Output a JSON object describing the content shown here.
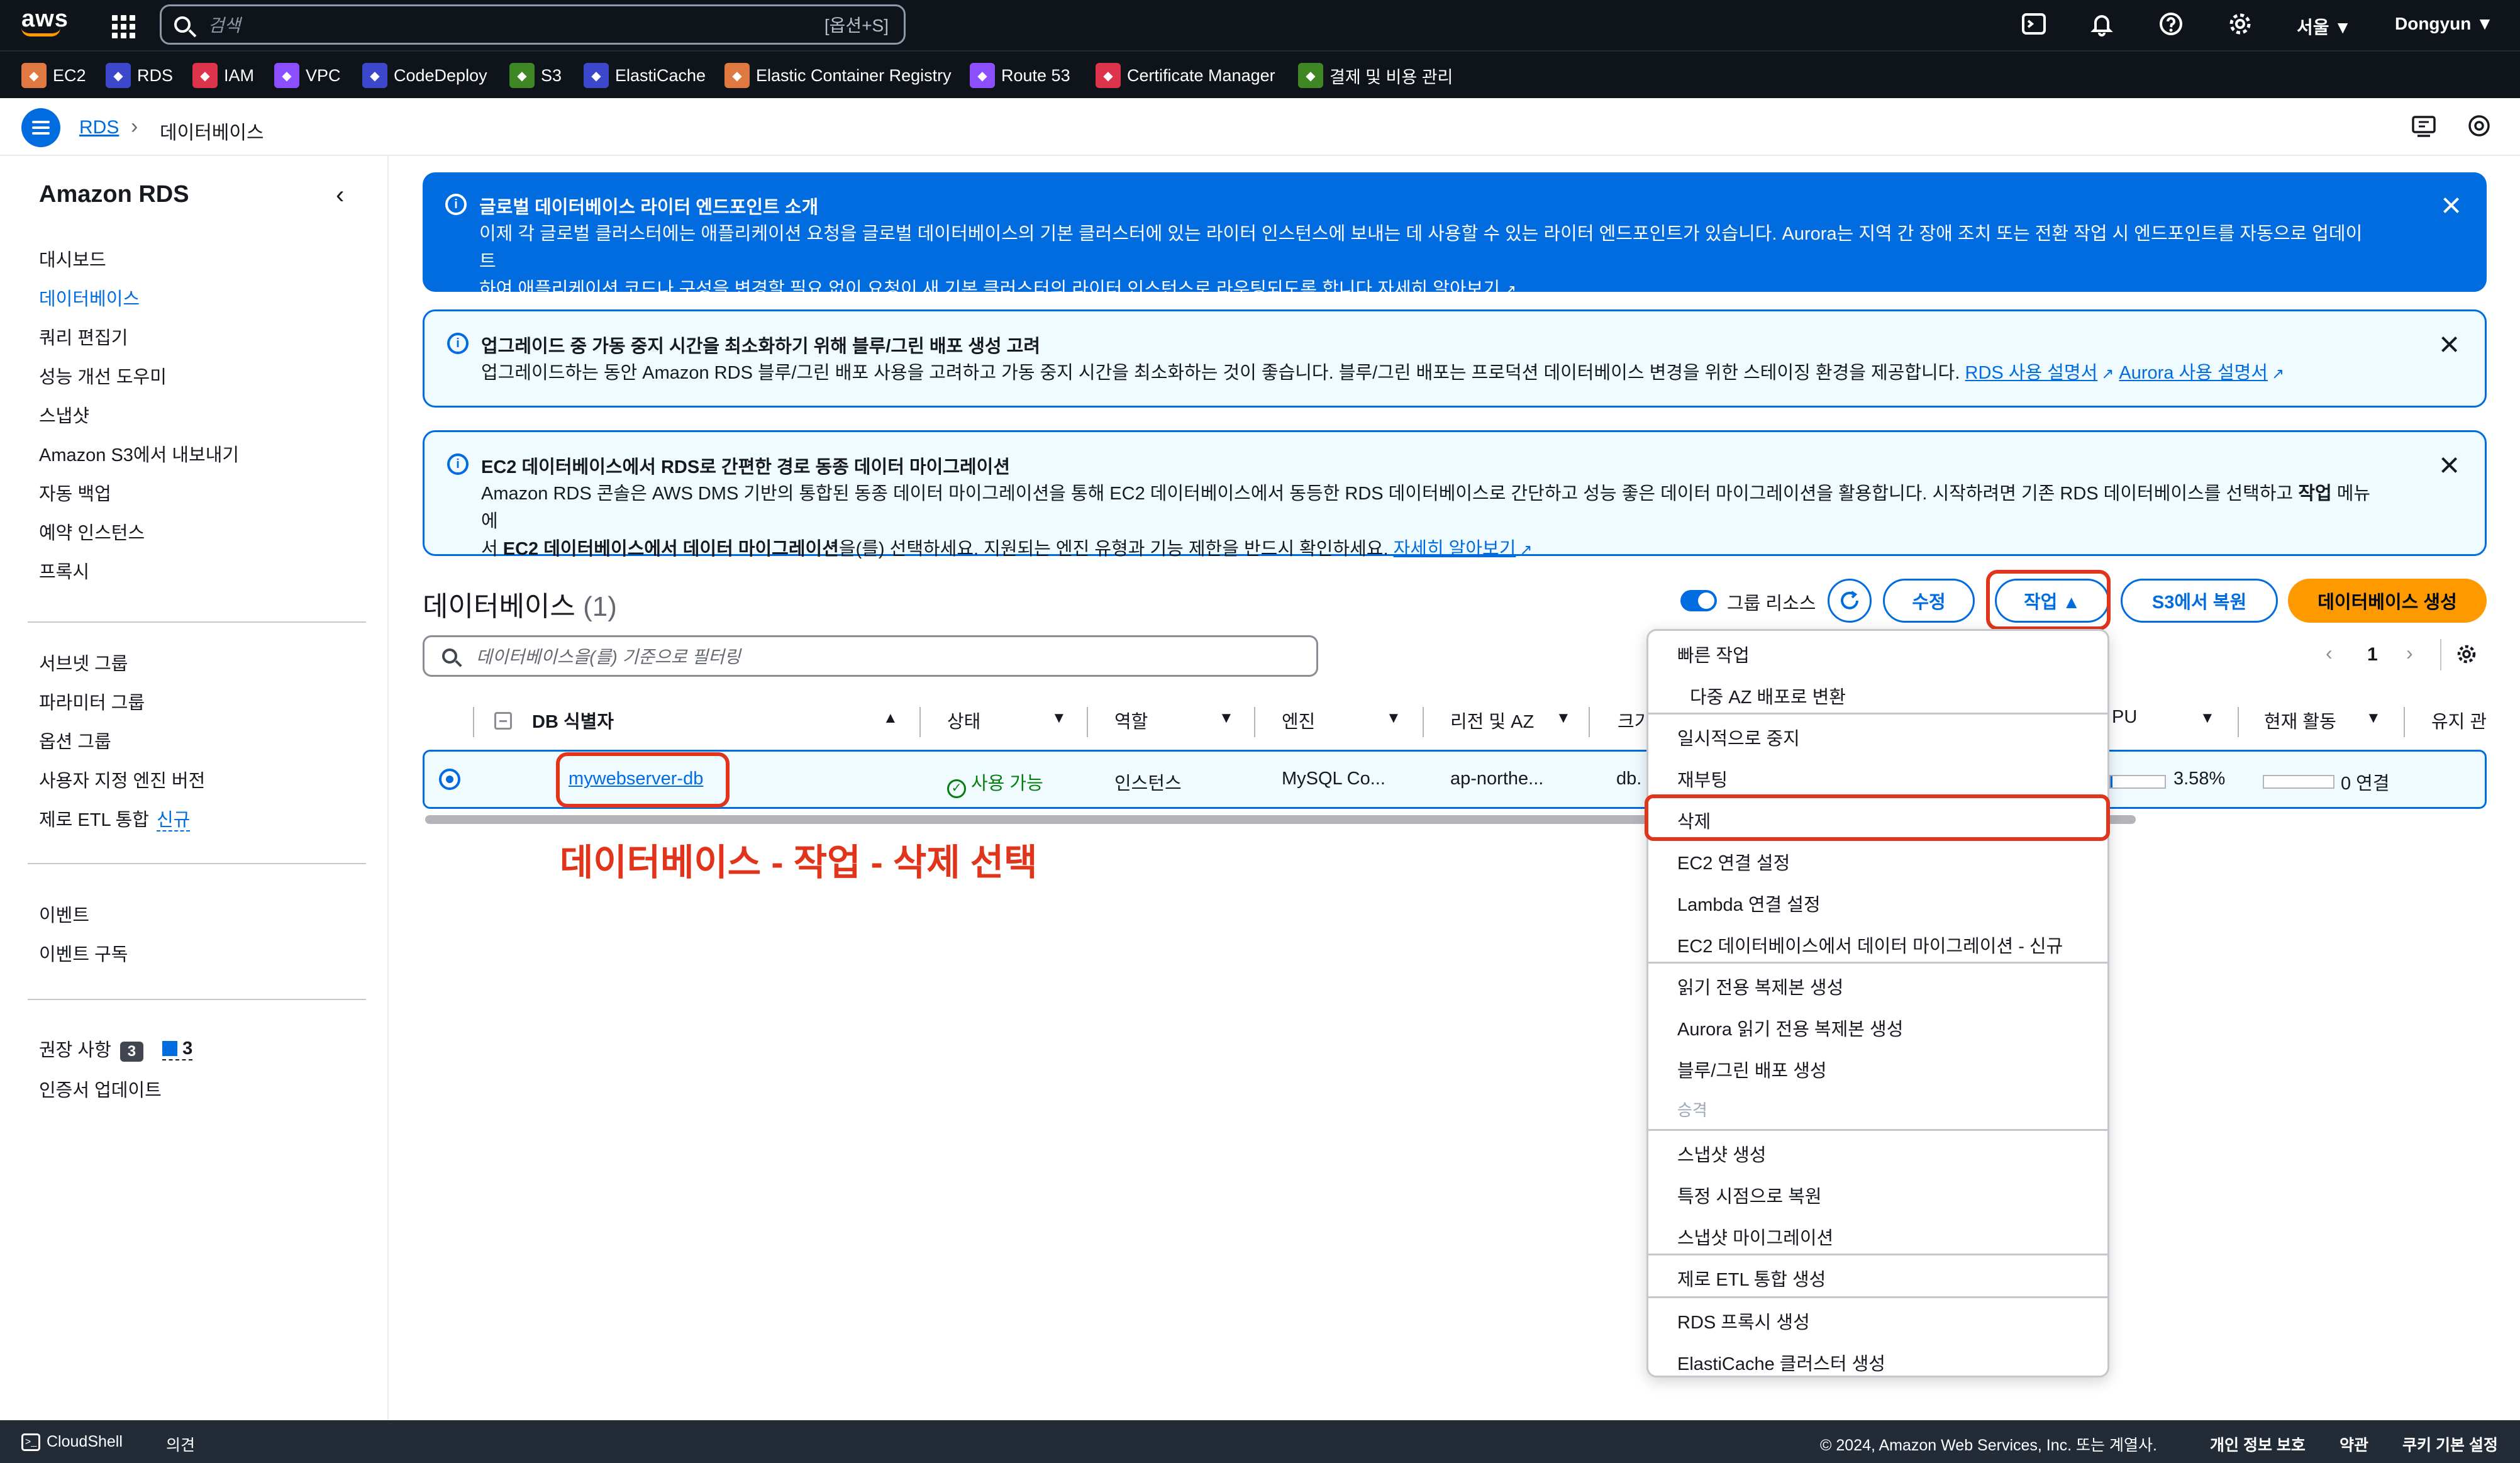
{
  "topnav": {
    "logo": "aws",
    "search_placeholder": "검색",
    "search_shortcut": "[옵션+S]",
    "region": "서울 ▼",
    "user": "Dongyun ▼",
    "icons": [
      "grid-icon",
      "cloudshell-icon",
      "bell-icon",
      "help-icon",
      "gear-icon"
    ]
  },
  "favorites": [
    {
      "label": "EC2",
      "color": "#e07941"
    },
    {
      "label": "RDS",
      "color": "#3b48cc"
    },
    {
      "label": "IAM",
      "color": "#dd344c"
    },
    {
      "label": "VPC",
      "color": "#8c4fff"
    },
    {
      "label": "CodeDeploy",
      "color": "#3b48cc"
    },
    {
      "label": "S3",
      "color": "#3f8624"
    },
    {
      "label": "ElastiCache",
      "color": "#3b48cc"
    },
    {
      "label": "Elastic Container Registry",
      "color": "#e07941"
    },
    {
      "label": "Route 53",
      "color": "#8c4fff"
    },
    {
      "label": "Certificate Manager",
      "color": "#dd344c"
    },
    {
      "label": "결제 및 비용 관리",
      "color": "#3f8624"
    }
  ],
  "breadcrumb": {
    "root": "RDS",
    "current": "데이터베이스"
  },
  "sidebar": {
    "title": "Amazon RDS",
    "group1": [
      "대시보드",
      "데이터베이스",
      "쿼리 편집기",
      "성능 개선 도우미",
      "스냅샷",
      "Amazon S3에서 내보내기",
      "자동 백업",
      "예약 인스턴스",
      "프록시"
    ],
    "group2": [
      "서브넷 그룹",
      "파라미터 그룹",
      "옵션 그룹",
      "사용자 지정 엔진 버전",
      "제로 ETL 통합"
    ],
    "new_badge": "신규",
    "group3": [
      "이벤트",
      "이벤트 구독"
    ],
    "recommendations": "권장 사항",
    "rec_count": "3",
    "rec_count2": "3",
    "cert_update": "인증서 업데이트"
  },
  "flash": {
    "global": {
      "title": "글로벌 데이터베이스 라이터 엔드포인트 소개",
      "line1": "이제 각 글로벌 클러스터에는 애플리케이션 요청을 글로벌 데이터베이스의 기본 클러스터에 있는 라이터 인스턴스에 보내는 데 사용할 수 있는 라이터 엔드포인트가 있습니다. Aurora는 지역 간 장애 조치 또는 전환 작업 시 엔드포인트를 자동으로 업데이트",
      "line2": "하여 애플리케이션 코드나 구성을 변경할 필요 없이 요청이 새 기본 클러스터의 라이터 인스턴스로 라우팅되도록 합니다.",
      "link": "자세히 알아보기"
    },
    "bluegreen": {
      "title": "업그레이드 중 가동 중지 시간을 최소화하기 위해 블루/그린 배포 생성 고려",
      "body": "업그레이드하는 동안 Amazon RDS 블루/그린 배포 사용을 고려하고 가동 중지 시간을 최소화하는 것이 좋습니다. 블루/그린 배포는 프로덕션 데이터베이스 변경을 위한 스테이징 환경을 제공합니다.",
      "link1": "RDS 사용 설명서",
      "link2": "Aurora 사용 설명서"
    },
    "migration": {
      "title": "EC2 데이터베이스에서 RDS로 간편한 경로 동종 데이터 마이그레이션",
      "line1": "Amazon RDS 콘솔은 AWS DMS 기반의 통합된 동종 데이터 마이그레이션을 통해 EC2 데이터베이스에서 동등한 RDS 데이터베이스로 간단하고 성능 좋은 데이터 마이그레이션을 활용합니다. 시작하려면 기존 RDS 데이터베이스를 선택하고 ",
      "bold1": "작업",
      "line1b": " 메뉴에",
      "line2a": "서 ",
      "bold2": "EC2 데이터베이스에서 데이터 마이그레이션",
      "line2b": "을(를) 선택하세요. 지원되는 엔진 유형과 기능 제한을 반드시 확인하세요. ",
      "link": "자세히 알아보기"
    }
  },
  "databases": {
    "title": "데이터베이스",
    "count": "(1)",
    "group_resources": "그룹 리소스",
    "modify": "수정",
    "actions": "작업 ▲",
    "restore_s3": "S3에서 복원",
    "create": "데이터베이스 생성",
    "filter_placeholder": "데이터베이스을(를) 기준으로 필터링",
    "page": "1",
    "columns": {
      "id": "DB 식별자",
      "status": "상태",
      "role": "역할",
      "engine": "엔진",
      "region": "리전 및 AZ",
      "size": "크기",
      "cpu": "PU",
      "activity": "현재 활동",
      "maint": "유지 관"
    },
    "row": {
      "id": "mywebserver-db",
      "status": "사용 가능",
      "role": "인스턴스",
      "engine": "MySQL Co...",
      "region": "ap-northe...",
      "size": "db.",
      "cpu_value": "3.58%",
      "cpu_fraction": 0.0358,
      "activity": "0 연결"
    }
  },
  "annotation": "데이터베이스 - 작업 - 삭제 선택",
  "actions_menu": {
    "quick_header": "빠른 작업",
    "quick_items": [
      "다중 AZ 배포로 변환"
    ],
    "group1": [
      "일시적으로 중지",
      "재부팅",
      "삭제",
      "EC2 연결 설정",
      "Lambda 연결 설정",
      "EC2 데이터베이스에서 데이터 마이그레이션 - 신규"
    ],
    "group2": [
      "읽기 전용 복제본 생성",
      "Aurora 읽기 전용 복제본 생성",
      "블루/그린 배포 생성",
      "승격"
    ],
    "group3": [
      "스냅샷 생성",
      "특정 시점으로 복원",
      "스냅샷 마이그레이션"
    ],
    "group4": [
      "제로 ETL 통합 생성"
    ],
    "group5": [
      "RDS 프록시 생성",
      "ElastiCache 클러스터 생성"
    ]
  },
  "footer": {
    "cloudshell": "CloudShell",
    "feedback": "의견",
    "copyright": "© 2024, Amazon Web Services, Inc. 또는 계열사.",
    "privacy": "개인 정보 보호",
    "terms": "약관",
    "cookies": "쿠키 기본 설정"
  }
}
